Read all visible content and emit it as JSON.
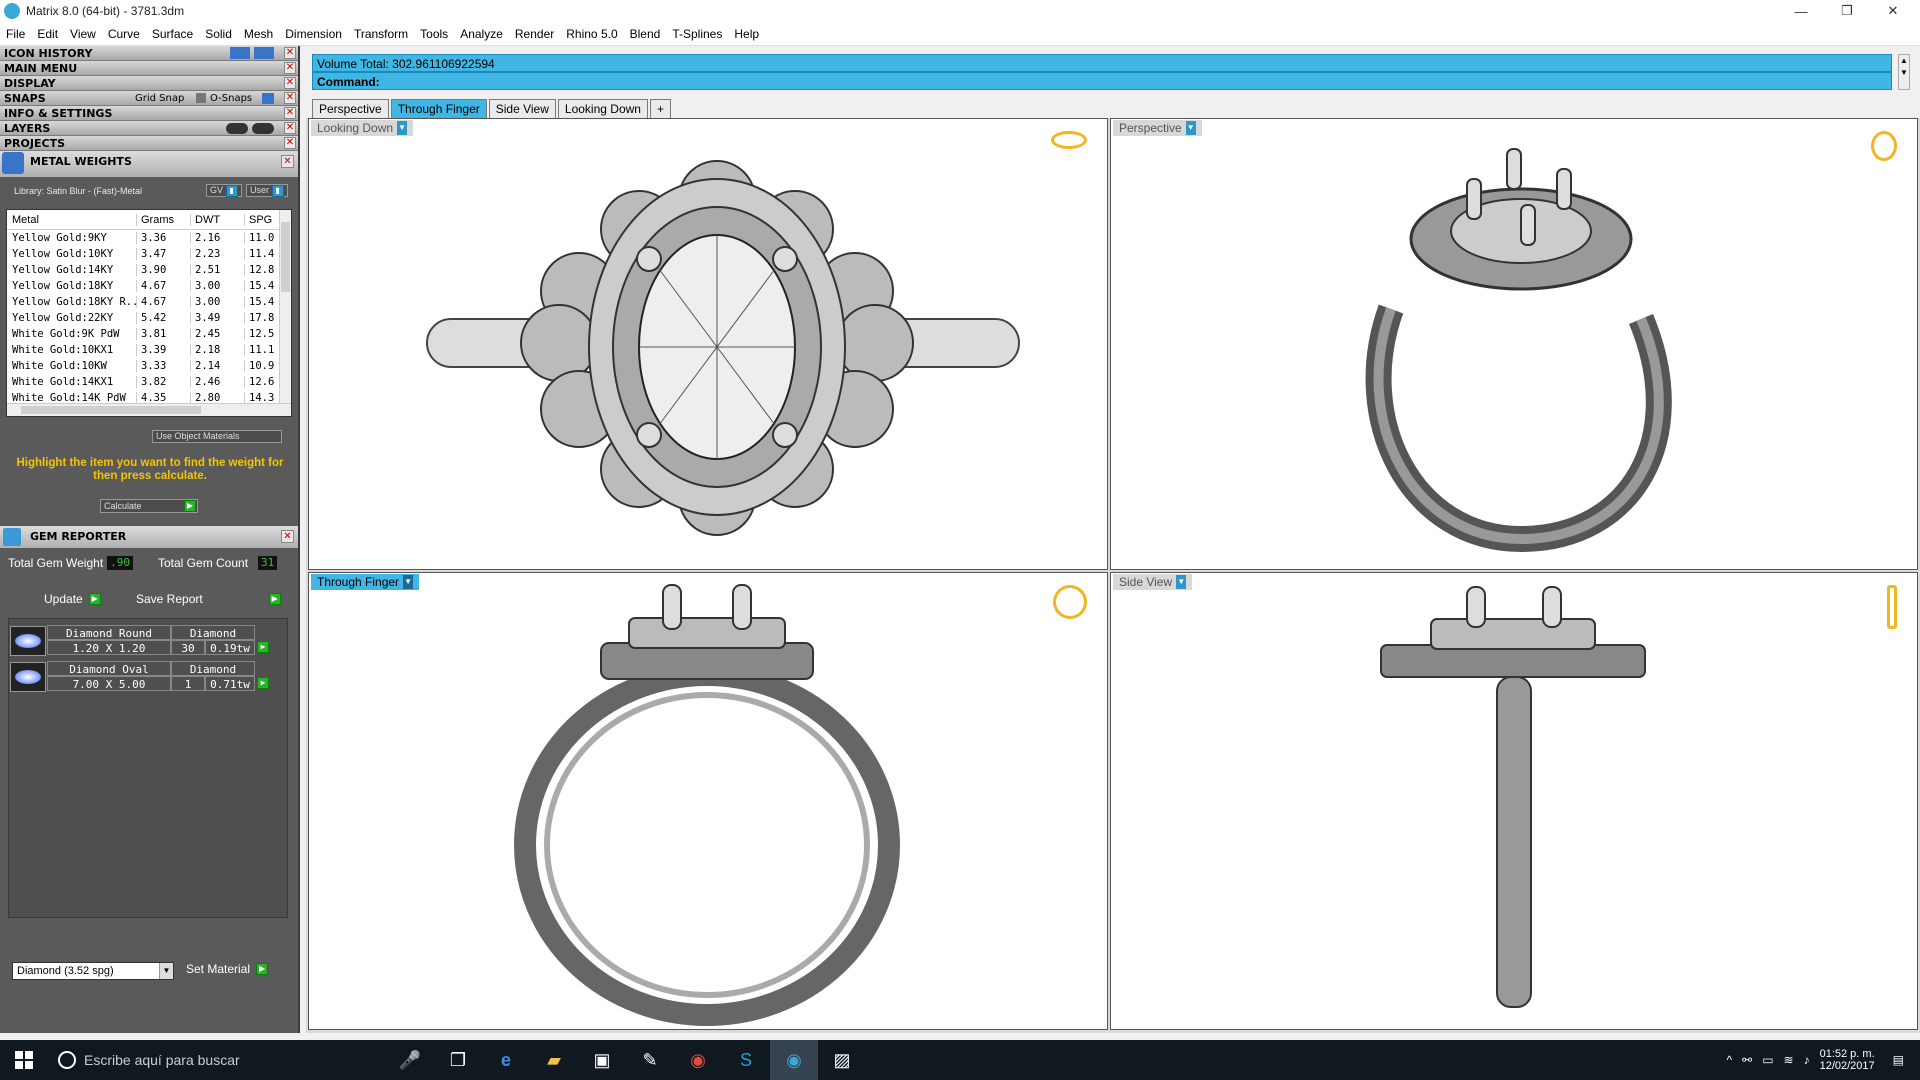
{
  "window": {
    "title": "Matrix 8.0 (64-bit) - 3781.3dm",
    "minimize": "—",
    "restore": "❐",
    "close": "✕"
  },
  "menu": [
    "File",
    "Edit",
    "View",
    "Curve",
    "Surface",
    "Solid",
    "Mesh",
    "Dimension",
    "Transform",
    "Tools",
    "Analyze",
    "Render",
    "Rhino 5.0",
    "Blend",
    "T-Splines",
    "Help"
  ],
  "panels": {
    "icon_history": "ICON HISTORY",
    "main_menu": "MAIN MENU",
    "display": "DISPLAY",
    "snaps": "SNAPS",
    "grid_snap": "Grid Snap",
    "osnaps": "O-Snaps",
    "info_settings": "INFO & SETTINGS",
    "layers": "LAYERS",
    "projects": "PROJECTS"
  },
  "metal_weights": {
    "title": "METAL WEIGHTS",
    "library": "Library: Satin Blur - (Fast)-Metal",
    "gv": "GV",
    "user": "User",
    "columns": [
      "Metal",
      "Grams",
      "DWT",
      "SPG"
    ],
    "rows": [
      [
        "Yellow Gold:9KY",
        "3.36",
        "2.16",
        "11.0"
      ],
      [
        "Yellow Gold:10KY",
        "3.47",
        "2.23",
        "11.4"
      ],
      [
        "Yellow Gold:14KY",
        "3.90",
        "2.51",
        "12.8"
      ],
      [
        "Yellow Gold:18KY",
        "4.67",
        "3.00",
        "15.4"
      ],
      [
        "Yellow Gold:18KY R...",
        "4.67",
        "3.00",
        "15.4"
      ],
      [
        "Yellow Gold:22KY",
        "5.42",
        "3.49",
        "17.8"
      ],
      [
        "White Gold:9K PdW",
        "3.81",
        "2.45",
        "12.5"
      ],
      [
        "White Gold:10KX1",
        "3.39",
        "2.18",
        "11.1"
      ],
      [
        "White Gold:10KW",
        "3.33",
        "2.14",
        "10.9"
      ],
      [
        "White Gold:14KX1",
        "3.82",
        "2.46",
        "12.6"
      ],
      [
        "White Gold:14K PdW",
        "4.35",
        "2.80",
        "14.3"
      ]
    ],
    "use_object_materials": "Use Object Materials",
    "instruction": "Highlight the item you want to find the weight for then press calculate.",
    "calculate": "Calculate"
  },
  "gem_reporter": {
    "title": "GEM REPORTER",
    "total_gem_weight_label": "Total Gem Weight",
    "total_gem_weight": ".90",
    "total_gem_count_label": "Total Gem Count",
    "total_gem_count": "31",
    "update": "Update",
    "save_report": "Save Report",
    "gems": [
      {
        "name": "Diamond Round",
        "type": "Diamond",
        "size": "1.20 X 1.20",
        "qty": "30",
        "weight": "0.19tw"
      },
      {
        "name": "Diamond Oval",
        "type": "Diamond",
        "size": "7.00 X 5.00",
        "qty": "1",
        "weight": "0.71tw"
      }
    ],
    "material_select": "Diamond    (3.52 spg)",
    "set_material": "Set Material"
  },
  "command": {
    "volume": "Volume Total: 302.961106922594",
    "command_label": "Command:"
  },
  "view_tabs": [
    "Perspective",
    "Through Finger",
    "Side View",
    "Looking Down",
    "+"
  ],
  "viewports": {
    "top_left": "Looking Down",
    "top_right": "Perspective",
    "bottom_left": "Through Finger",
    "bottom_right": "Side View"
  },
  "taskbar": {
    "search_placeholder": "Escribe aquí para buscar",
    "time": "01:52 p. m.",
    "date": "12/02/2017"
  },
  "colors": {
    "accent": "#3fb6e4",
    "panel_bg": "#5a5a5a",
    "highlight_text": "#f5c400"
  }
}
